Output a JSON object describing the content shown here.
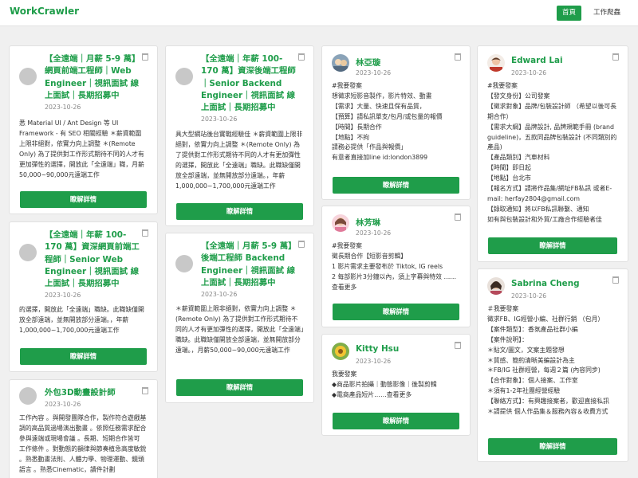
{
  "nav": {
    "brand": "WorkCrawler",
    "home": "首頁",
    "jobs": "工作爬蟲"
  },
  "theme": {
    "accent": "#1f9d4a"
  },
  "detail_label": "瞭解詳情",
  "cards": {
    "c1": {
      "title": "【全遠端｜月薪 5-9 萬】網頁前端工程師｜Web Engineer｜視訊面試 線上面試｜長期招募中",
      "date": "2023-10-26",
      "body": "悉 Material UI / Ant Design 等 UI Framework - 有 SEO 相關經驗 ＊薪資範圍上限非絕對，依實力向上調整 ＊(Remote Only) 為了提供對工作形式期待不同的人才有更加彈性的選擇，開放此「全遠端」職，月薪50,000~90,000元遠端工作"
    },
    "c2": {
      "title": "【全遠端｜年薪 100-170 萬】資深後端工程師｜Senior Backend Engineer｜視訊面試 線上面試｜長期招募中",
      "date": "2023-10-26",
      "body": "具大型網站後台實戰經驗佳 ＊薪資範圍上限非絕對，依實力向上調整 ＊(Remote Only) 為了提供對工作形式期待不同的人才有更加彈性的選擇，開放此「全遠端」職缺。此職缺僅開放全部遠端，並無開放部分遠端。，年薪1,000,000~1,700,000元遠端工作"
    },
    "c3": {
      "name": "林亞璇",
      "date": "2023-10-26",
      "body": "#我要發案\n想徵求短影音製作，影片特效、動畫\n【需求】大量、快速且保有品質，\n【預算】請私訊單支/包月/或包量的報價\n【時間】長期合作\n【地點】不拘\n請務必提供「作品與報價」\n有意者直接加line id:london3899"
    },
    "c4": {
      "name": "Edward Lai",
      "date": "2023-10-26",
      "body": "#我要發案\n【發文身份】公司發案\n【徵求對象】品牌/包裝設計師 （希望以後可長期合作）\n【需求大綱】品牌設計, 品牌規範手冊 (brand guideline)，五款同品牌包裝設計 (不同類別的產品)\n【產品類別】汽車材料\n【時間】即日起\n【地點】台北市\n【報名方式】請將作品集/網址FB私訊 或者E-mail: herfay2804@gmail.com\n【錄取通知】將以FB私訊聯繫、通知\n如有與包裝設計和外貿/工廠合作經驗者佳"
    },
    "c5": {
      "name": "林芳琳",
      "date": "2023-10-26",
      "body": "#我要發案\n徵長期合作【短影音剪輯】\n1 影片需求主要發布於 Tiktok, IG reels\n2 每部影片3分鐘以內，須上字幕與特效 ……\n查看更多"
    },
    "c6": {
      "title": "【全遠端｜年薪 100-170 萬】資深網頁前端工程師｜Senior Web Engineer｜視訊面試 線上面試｜長期招募中",
      "date": "2023-10-26",
      "body": "的選擇，開放此「全遠端」職缺。此職缺僅開放全部遠端，並無開放部分遠端。，年薪1,000,000~1,700,000元遠端工作"
    },
    "c7": {
      "title": "【全遠端｜月薪 5-9 萬】後端工程師 Backend Engineer｜視訊面試 線上面試｜長期招募中",
      "date": "2023-10-26",
      "body": "＊薪資範圍上限非絕對，依實力向上調整 ＊(Remote Only) 為了提供對工作形式期待不同的人才有更加彈性的選擇，開放此「全遠端」職缺。此職缺僅開放全部遠端，並無開放部分遠端。，月薪50,000~90,000元遠端工作"
    },
    "c8": {
      "name": "Sabrina Cheng",
      "date": "2023-10-26",
      "body": "＃我要發案\n徵求FB、IG經營小編、社群行銷 （包月）\n【案件類型】：香氛產品社群小編\n【案件說明】：\n＊貼文/圖文，文案主題發想\n＊質感、簡約清晰美編設計為主\n＊FB/IG 社群經營，每週２篇 (內容同步)\n【合作對象】：個人接案、工作室\n＊須有1-2年社團經營經驗\n【聯絡方式】：有興趣接案者，歡迎直接私訊\n＊請提供 個人作品集＆服務內容＆收費方式"
    },
    "c9": {
      "name": "Kitty Hsu",
      "date": "2023-10-26",
      "body": "我要發案\n◆商品影片拍攝｜動態影像｜後製剪輯\n◆電商產品短片……查看更多"
    },
    "c10": {
      "title": "外包3D動畫設計師",
      "date": "2023-10-26",
      "body": "工作內容 。與開發團隊合作，製作符合遊戲基調的高品質過場演出動畫 。依照任務需求配合參與遠端或現場會議 。長期、短期合作皆可 工作條件 。對動態的韻律與節奏植急高度敏銳 。熟悉動畫法則、人體力學、物理運動、鏡頭語言 。熟悉Cinematic，讀件計劃"
    }
  }
}
